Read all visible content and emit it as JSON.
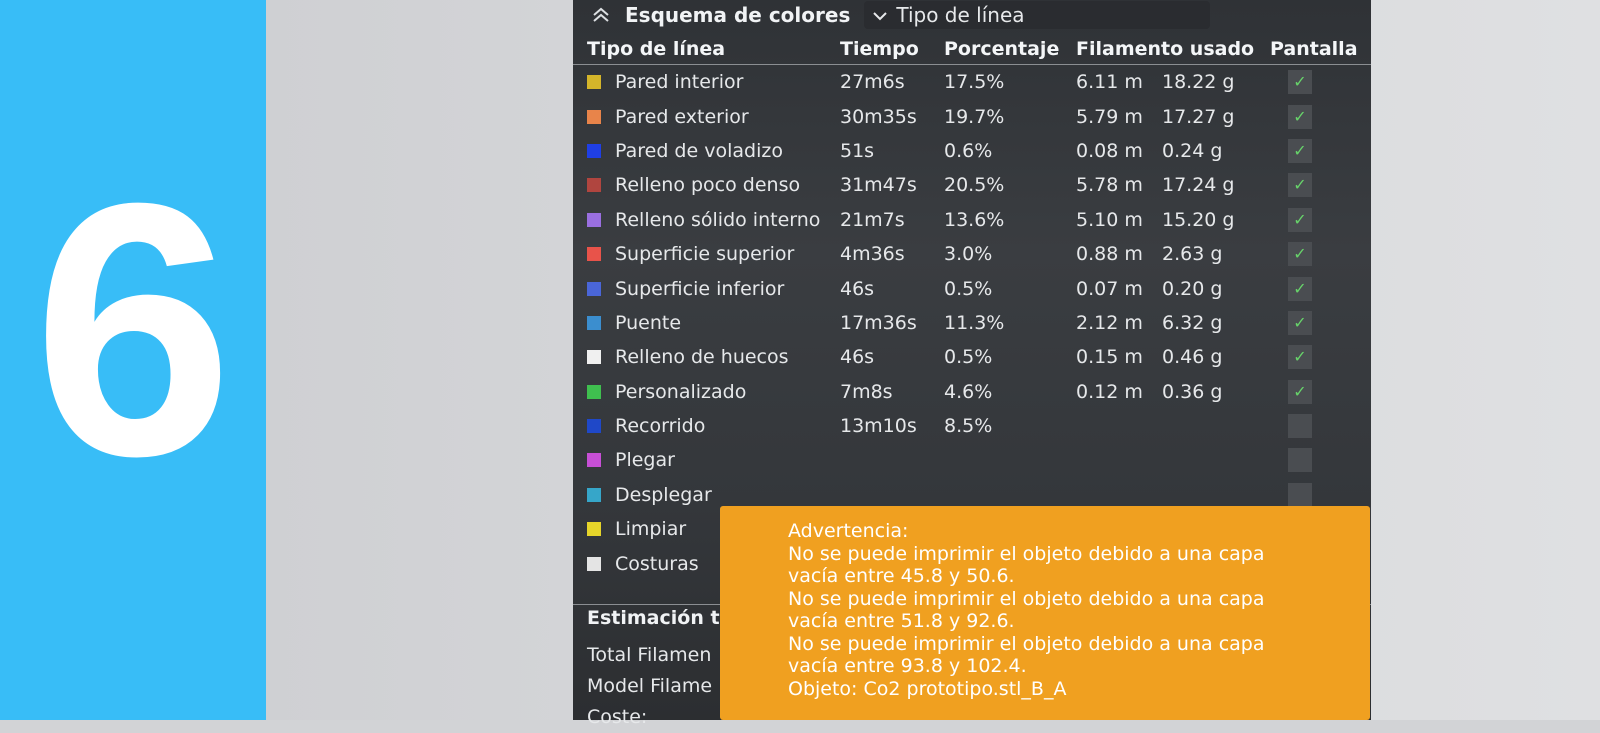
{
  "step_number": "6",
  "colors": {
    "band": "#38bdf7",
    "panel": "#34373b",
    "warning": "#f0a020",
    "check": "#67d36a"
  },
  "panel": {
    "title": "Esquema de colores",
    "dropdown_value": "Tipo de línea",
    "headers": {
      "name": "Tipo de línea",
      "time": "Tiempo",
      "percent": "Porcentaje",
      "filament": "Filamento usado",
      "display": "Pantalla"
    },
    "rows": [
      {
        "name": "Pared interior",
        "color": "#d4b52a",
        "time": "27m6s",
        "percent": "17.5%",
        "length": "6.11 m",
        "weight": "18.22 g",
        "visible": true
      },
      {
        "name": "Pared exterior",
        "color": "#e8844a",
        "time": "30m35s",
        "percent": "19.7%",
        "length": "5.79 m",
        "weight": "17.27 g",
        "visible": true
      },
      {
        "name": "Pared de voladizo",
        "color": "#1f3fe6",
        "time": "51s",
        "percent": "0.6%",
        "length": "0.08 m",
        "weight": "0.24 g",
        "visible": true
      },
      {
        "name": "Relleno poco denso",
        "color": "#b0453f",
        "time": "31m47s",
        "percent": "20.5%",
        "length": "5.78 m",
        "weight": "17.24 g",
        "visible": true
      },
      {
        "name": "Relleno sólido interno",
        "color": "#9a6fe0",
        "time": "21m7s",
        "percent": "13.6%",
        "length": "5.10 m",
        "weight": "15.20 g",
        "visible": true
      },
      {
        "name": "Superficie superior",
        "color": "#e8534a",
        "time": "4m36s",
        "percent": "3.0%",
        "length": "0.88 m",
        "weight": "2.63 g",
        "visible": true
      },
      {
        "name": "Superficie inferior",
        "color": "#4a66d8",
        "time": "46s",
        "percent": "0.5%",
        "length": "0.07 m",
        "weight": "0.20 g",
        "visible": true
      },
      {
        "name": "Puente",
        "color": "#3b8ecf",
        "time": "17m36s",
        "percent": "11.3%",
        "length": "2.12 m",
        "weight": "6.32 g",
        "visible": true
      },
      {
        "name": "Relleno de huecos",
        "color": "#f0f0f0",
        "time": "46s",
        "percent": "0.5%",
        "length": "0.15 m",
        "weight": "0.46 g",
        "visible": true
      },
      {
        "name": "Personalizado",
        "color": "#3fbf4f",
        "time": "7m8s",
        "percent": "4.6%",
        "length": "0.12 m",
        "weight": "0.36 g",
        "visible": true
      },
      {
        "name": "Recorrido",
        "color": "#1f48c8",
        "time": "13m10s",
        "percent": "8.5%",
        "length": "",
        "weight": "",
        "visible": false
      },
      {
        "name": "Plegar",
        "color": "#c74fd6",
        "time": "",
        "percent": "",
        "length": "",
        "weight": "",
        "visible": false
      },
      {
        "name": "Desplegar",
        "color": "#36a6c9",
        "time": "",
        "percent": "",
        "length": "",
        "weight": "",
        "visible": false
      },
      {
        "name": "Limpiar",
        "color": "#e6d52a",
        "time": "",
        "percent": "",
        "length": "",
        "weight": "",
        "visible": false
      },
      {
        "name": "Costuras",
        "color": "#e4e4e4",
        "time": "",
        "percent": "",
        "length": "",
        "weight": "",
        "visible": false
      }
    ],
    "estimate_title": "Estimación to",
    "summary": [
      "Total Filamen",
      "Model Filame",
      "Coste:"
    ]
  },
  "warning": {
    "lines": [
      "Advertencia:",
      "No se puede imprimir el objeto debido a una capa",
      "vacía entre 45.8 y 50.6.",
      "No se puede imprimir el objeto debido a una capa",
      "vacía entre 51.8 y 92.6.",
      "No se puede imprimir el objeto debido a una capa",
      "vacía entre 93.8 y 102.4.",
      "Objeto: Co2 prototipo.stl_B_A"
    ]
  }
}
